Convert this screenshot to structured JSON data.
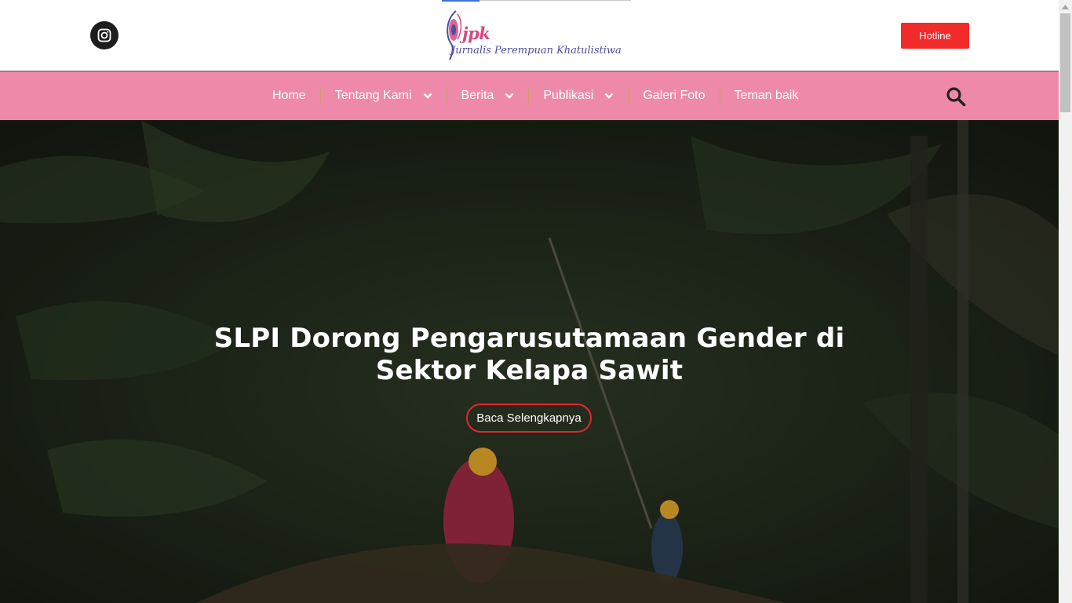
{
  "header": {
    "social_icon": "instagram-icon",
    "logo_abbr": "jpk",
    "logo_text": "Jurnalis Perempuan Khatulistiwa",
    "hotline_label": "Hotline"
  },
  "nav": {
    "items": [
      {
        "label": "Home",
        "dropdown": false
      },
      {
        "label": "Tentang Kami",
        "dropdown": true
      },
      {
        "label": "Berita",
        "dropdown": true
      },
      {
        "label": "Publikasi",
        "dropdown": true
      },
      {
        "label": "Galeri Foto",
        "dropdown": false
      },
      {
        "label": "Teman baik",
        "dropdown": false
      }
    ],
    "search_icon": "search-icon"
  },
  "hero": {
    "title_line1": "SLPI Dorong Pengarusutamaan Gender di",
    "title_line2": "Sektor Kelapa Sawit",
    "button_label": "Baca Selengkapnya"
  },
  "colors": {
    "nav_bg": "#ef89a9",
    "hotline_bg": "#f22a2a",
    "button_border": "#e3262e",
    "logo_pink": "#d9487f",
    "logo_blue": "#4a4f9e"
  }
}
